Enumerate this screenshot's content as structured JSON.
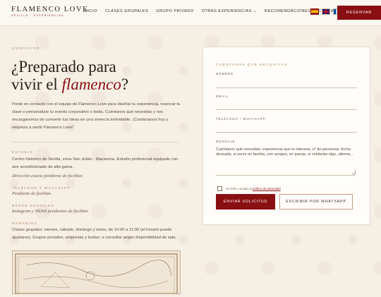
{
  "header": {
    "logo_title": "FLAMENCO LOVE",
    "logo_subtitle": "SEVILLA · EXPERIENCIAS",
    "nav": [
      "INICIO",
      "CLASES GRUPALES",
      "GRUPO PRIVADO",
      "OTRAS EXPERIENCIAS",
      "RECOMENDACIONES",
      "CONTACTO"
    ],
    "nav_dropdown_chevron": "⌄",
    "languages": [
      {
        "code": "es",
        "icon": "spain-flag-icon"
      },
      {
        "code": "en",
        "icon": "uk-flag-icon"
      },
      {
        "code": "fr",
        "icon": "france-flag-icon"
      }
    ],
    "reserve_label": "RESERVAR"
  },
  "hero": {
    "eyebrow": "CONTACTO",
    "headline_1": "¿Preparado para",
    "headline_2": "vivir el",
    "headline_accent": "flamenco",
    "headline_end": "?",
    "intro": "Ponte en contacto con el equipo de Flamenco Love para diseñar tu experiencia, reservar tu clase o personalizar tu evento corporativo o boda. Cuéntanos qué necesitas y nos encargaremos de convertir tus ideas en una vivencia inolvidable. ¡Contáctanos hoy y empieza a sentir Flamenco Love!"
  },
  "info": {
    "studio_label": "ESTUDIO",
    "studio_text": "Centro histórico de Sevilla, zona San Julián · Macarena. Estudio profesional equipado con aire acondicionado de alta gama.",
    "studio_pending": "Dirección exacta pendiente de facilitar.",
    "phone_label": "TELÉFONO Y WHATSAPP",
    "phone_pending": "Pendiente de facilitar.",
    "social_label": "REDES SOCIALES",
    "social_pending": "Instagram y TikTok pendientes de facilitar.",
    "hours_label": "HORARIOS",
    "hours_text": "Clases grupales: viernes, sábado, domingo y lunes, de 10:00 a 11:00 (el horario puede ajustarse). Grupos privados, empresas y bodas: a consultar según disponibilidad de sala."
  },
  "form": {
    "title": "CUÉNTANOS QUÉ NECESITAS",
    "name_label": "NOMBRE",
    "email_label": "EMAIL",
    "phone_label": "TELÉFONO / WHATSAPP",
    "message_label": "MENSAJE",
    "message_placeholder": "Cuéntanos qué necesitás: experiencia que te interesa, nº de personas, fecha deseada, si venís en familia, con amigos, en pareja, si celebráis algo, idioma...",
    "consent_prefix": "He leído y acepto la",
    "consent_link": "política de privacidad",
    "submit_label": "ENVIAR SOLICITUD",
    "whatsapp_label": "ESCRIBIR POR WHATSAPP"
  },
  "colors": {
    "brand_red": "#8a0f12",
    "gold": "#a3815d",
    "background": "#f6efe4"
  }
}
